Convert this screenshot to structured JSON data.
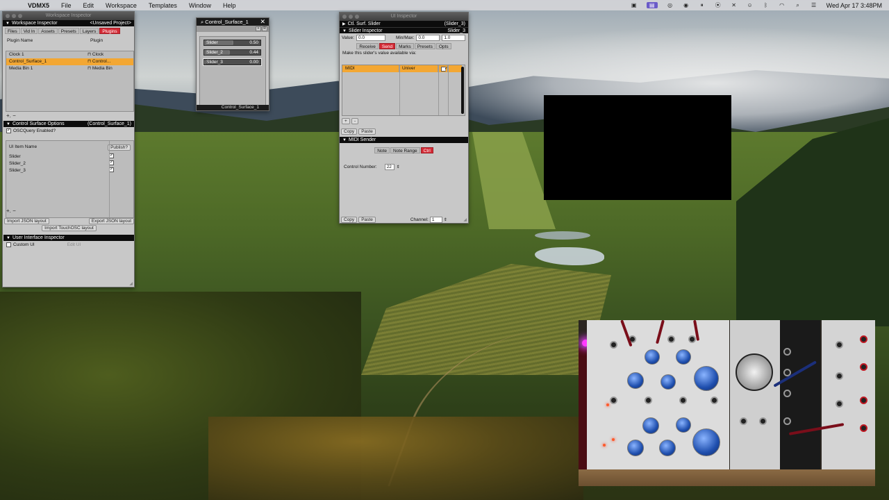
{
  "menubar": {
    "app": "VDMX5",
    "items": [
      "File",
      "Edit",
      "Workspace",
      "Templates",
      "Window",
      "Help"
    ],
    "datetime": "Wed Apr 17  3:48PM"
  },
  "workspace_inspector": {
    "window_title": "Workspace Inspector",
    "header_left": "Workspace Inspector",
    "header_right": "<Unsaved Project>",
    "tabs": [
      "Files",
      "Vid In",
      "Assets",
      "Presets",
      "Layers",
      "Plugins"
    ],
    "active_tab": "Plugins",
    "col_name": "Plugin Name",
    "col_plugin": "Plugin",
    "plugins": [
      {
        "name": "Clock 1",
        "plugin": "Clock"
      },
      {
        "name": "Control_Surface_1",
        "plugin": "Control..."
      },
      {
        "name": "Media Bin 1",
        "plugin": "Media Bin"
      }
    ],
    "cso_title": "Control Surface Options",
    "cso_target": "(Control_Surface_1)",
    "oscquery_label": "OSCQuery Enabled?",
    "ui_item_name": "UI Item Name",
    "publish_label": "Publish?",
    "ui_items": [
      "Slider",
      "Slider_2",
      "Slider_3"
    ],
    "import_json": "Import JSON layout",
    "export_json": "Export JSON layout",
    "import_touchosc": "Import TouchOSC layout",
    "uii_title": "User Interface Inspector",
    "custom_ui": "Custom UI",
    "edit_ui": "Edit UI"
  },
  "control_surface": {
    "title": "Control_Surface_1",
    "footer": "Control_Surface_1",
    "sliders": [
      {
        "label": "Slider",
        "value_text": "0.50",
        "value": 0.5
      },
      {
        "label": "Slider_2",
        "value_text": "0.44",
        "value": 0.44
      },
      {
        "label": "Slider_3",
        "value_text": "0.00",
        "value": 0.0
      }
    ]
  },
  "ui_inspector": {
    "window_title": "UI Inspector",
    "row1_left": "Ctl. Surf. Slider",
    "row1_right": "(Slider_3)",
    "row2_left": "Slider Inspector",
    "row2_right": "Slider_3",
    "value_label": "Value:",
    "value": "0.0",
    "minmax_label": "Min/Max:",
    "min": "0.0",
    "max": "1.0",
    "tabs": [
      "Receive",
      "Send",
      "Marks",
      "Presets",
      "Opts"
    ],
    "active_tab": "Send",
    "available_text": "Make this slider's value available via:",
    "midi_row": {
      "type": "MIDI",
      "dest": "Univer"
    },
    "copy": "Copy",
    "paste": "Paste",
    "midi_sender": "MIDI Sender",
    "sender_tabs": [
      "Note",
      "Note Range",
      "Ctrl"
    ],
    "sender_active": "Ctrl",
    "control_number_label": "Control Number:",
    "control_number": "22",
    "channel_label": "Channel:",
    "channel": "1"
  }
}
